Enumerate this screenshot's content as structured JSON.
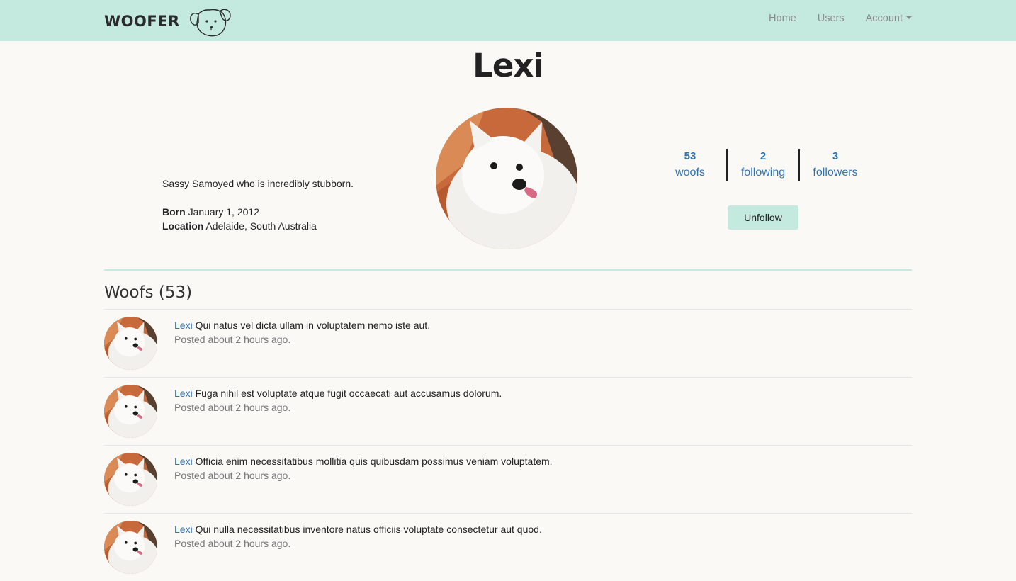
{
  "brand": {
    "name": "WOOFER",
    "logo_icon": "dog-face-icon"
  },
  "nav": {
    "home": "Home",
    "users": "Users",
    "account": "Account"
  },
  "profile": {
    "name": "Lexi",
    "bio": "Sassy Samoyed who is incredibly stubborn.",
    "born_label": "Born",
    "born_value": "January 1, 2012",
    "location_label": "Location",
    "location_value": "Adelaide, South Australia"
  },
  "stats": [
    {
      "count": "53",
      "label": "woofs"
    },
    {
      "count": "2",
      "label": "following"
    },
    {
      "count": "3",
      "label": "followers"
    }
  ],
  "unfollow_label": "Unfollow",
  "woofs_heading": "Woofs (53)",
  "woofs": [
    {
      "author": "Lexi",
      "content": "Qui natus vel dicta ullam in voluptatem nemo iste aut.",
      "time": "Posted about 2 hours ago."
    },
    {
      "author": "Lexi",
      "content": "Fuga nihil est voluptate atque fugit occaecati aut accusamus dolorum.",
      "time": "Posted about 2 hours ago."
    },
    {
      "author": "Lexi",
      "content": "Officia enim necessitatibus mollitia quis quibusdam possimus veniam voluptatem.",
      "time": "Posted about 2 hours ago."
    },
    {
      "author": "Lexi",
      "content": "Qui nulla necessitatibus inventore natus officiis voluptate consectetur aut quod.",
      "time": "Posted about 2 hours ago."
    }
  ],
  "colors": {
    "navbar": "#c4eae0",
    "link": "#2f73b5",
    "background": "#faf9f6"
  }
}
